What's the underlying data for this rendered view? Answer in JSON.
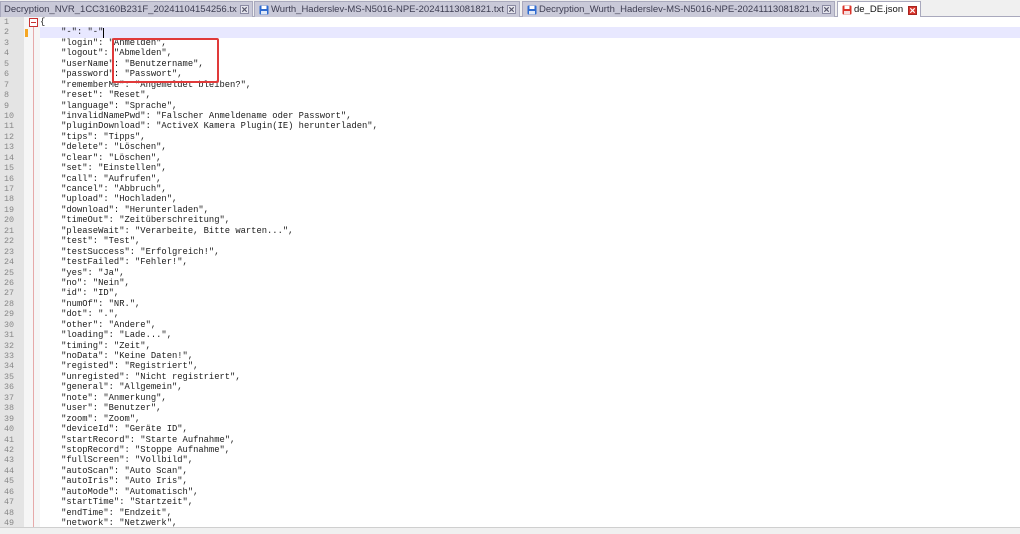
{
  "tabs": [
    {
      "label": "Decryption_NVR_1CC3160B231F_20241104154256.txt",
      "close_icon": "close-tab-icon"
    },
    {
      "label": "Wurth_Haderslev-MS-N5016-NPE-20241113081821.txt",
      "icon": "saved-file-icon",
      "close_icon": "close-tab-icon"
    },
    {
      "label": "Decryption_Wurth_Haderslev-MS-N5016-NPE-20241113081821.txt",
      "icon": "saved-file-icon",
      "close_icon": "close-tab-icon"
    },
    {
      "label": "de_DE.json",
      "icon": "unsaved-file-icon",
      "close_icon": "close-tab-icon",
      "active": true
    }
  ],
  "colors": {
    "annotation": "#e03a3a",
    "current_line_bg": "#e8e8ff",
    "change_marker": "#f5a623",
    "saved_icon": "#2f6bd0",
    "unsaved_icon": "#d9342b"
  },
  "editor": {
    "current_line": 2,
    "fold_icon": "fold-collapse-icon",
    "lines": [
      {
        "num": "1",
        "code": "{"
      },
      {
        "num": "2",
        "code": "\t\"-\": \"-\""
      },
      {
        "num": "3",
        "code": "\t\"login\": \"Anmelden\","
      },
      {
        "num": "4",
        "code": "\t\"logout\": \"Abmelden\","
      },
      {
        "num": "5",
        "code": "\t\"userName\": \"Benutzername\","
      },
      {
        "num": "6",
        "code": "\t\"password\": \"Passwort\","
      },
      {
        "num": "7",
        "code": "\t\"rememberMe\": \"Angemeldet bleiben?\","
      },
      {
        "num": "8",
        "code": "\t\"reset\": \"Reset\","
      },
      {
        "num": "9",
        "code": "\t\"language\": \"Sprache\","
      },
      {
        "num": "10",
        "code": "\t\"invalidNamePwd\": \"Falscher Anmeldename oder Passwort\","
      },
      {
        "num": "11",
        "code": "\t\"pluginDownload\": \"ActiveX Kamera Plugin(IE) herunterladen\","
      },
      {
        "num": "12",
        "code": "\t\"tips\": \"Tipps\","
      },
      {
        "num": "13",
        "code": "\t\"delete\": \"Löschen\","
      },
      {
        "num": "14",
        "code": "\t\"clear\": \"Löschen\","
      },
      {
        "num": "15",
        "code": "\t\"set\": \"Einstellen\","
      },
      {
        "num": "16",
        "code": "\t\"call\": \"Aufrufen\","
      },
      {
        "num": "17",
        "code": "\t\"cancel\": \"Abbruch\","
      },
      {
        "num": "18",
        "code": "\t\"upload\": \"Hochladen\","
      },
      {
        "num": "19",
        "code": "\t\"download\": \"Herunterladen\","
      },
      {
        "num": "20",
        "code": "\t\"timeOut\": \"Zeitüberschreitung\","
      },
      {
        "num": "21",
        "code": "\t\"pleaseWait\": \"Verarbeite, Bitte warten...\","
      },
      {
        "num": "22",
        "code": "\t\"test\": \"Test\","
      },
      {
        "num": "23",
        "code": "\t\"testSuccess\": \"Erfolgreich!\","
      },
      {
        "num": "24",
        "code": "\t\"testFailed\": \"Fehler!\","
      },
      {
        "num": "25",
        "code": "\t\"yes\": \"Ja\","
      },
      {
        "num": "26",
        "code": "\t\"no\": \"Nein\","
      },
      {
        "num": "27",
        "code": "\t\"id\": \"ID\","
      },
      {
        "num": "28",
        "code": "\t\"numOf\": \"NR.\","
      },
      {
        "num": "29",
        "code": "\t\"dot\": \".\","
      },
      {
        "num": "30",
        "code": "\t\"other\": \"Andere\","
      },
      {
        "num": "31",
        "code": "\t\"loading\": \"Lade...\","
      },
      {
        "num": "32",
        "code": "\t\"timing\": \"Zeit\","
      },
      {
        "num": "33",
        "code": "\t\"noData\": \"Keine Daten!\","
      },
      {
        "num": "34",
        "code": "\t\"registed\": \"Registriert\","
      },
      {
        "num": "35",
        "code": "\t\"unregisted\": \"Nicht registriert\","
      },
      {
        "num": "36",
        "code": "\t\"general\": \"Allgemein\","
      },
      {
        "num": "37",
        "code": "\t\"note\": \"Anmerkung\","
      },
      {
        "num": "38",
        "code": "\t\"user\": \"Benutzer\","
      },
      {
        "num": "39",
        "code": "\t\"zoom\": \"Zoom\","
      },
      {
        "num": "40",
        "code": "\t\"deviceId\": \"Geräte ID\","
      },
      {
        "num": "41",
        "code": "\t\"startRecord\": \"Starte Aufnahme\","
      },
      {
        "num": "42",
        "code": "\t\"stopRecord\": \"Stoppe Aufnahme\","
      },
      {
        "num": "43",
        "code": "\t\"fullScreen\": \"Vollbild\","
      },
      {
        "num": "44",
        "code": "\t\"autoScan\": \"Auto Scan\","
      },
      {
        "num": "45",
        "code": "\t\"autoIris\": \"Auto Iris\","
      },
      {
        "num": "46",
        "code": "\t\"autoMode\": \"Automatisch\","
      },
      {
        "num": "47",
        "code": "\t\"startTime\": \"Startzeit\","
      },
      {
        "num": "48",
        "code": "\t\"endTime\": \"Endzeit\","
      },
      {
        "num": "49",
        "code": "\t\"network\": \"Netzwerk\","
      }
    ]
  }
}
